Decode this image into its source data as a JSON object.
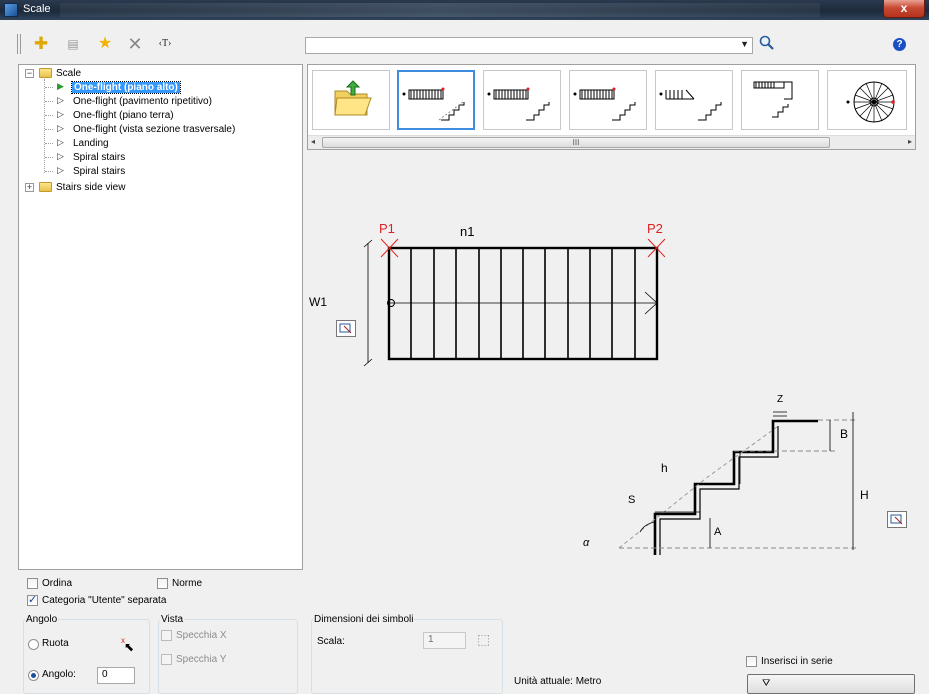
{
  "window": {
    "title": "Scale",
    "close_label": "x"
  },
  "toolbar": {
    "search_value": "",
    "help_label": "?",
    "text_tool_label": "‹T›"
  },
  "tree": {
    "root": "Scale",
    "items": [
      "One-flight (piano alto)",
      "One-flight (pavimento ripetitivo)",
      "One-flight (piano terra)",
      "One-flight (vista sezione trasversale)",
      "Landing",
      "Spiral stairs",
      "Spiral stairs"
    ],
    "second_root": "Stairs side view"
  },
  "thumbnails": {
    "scroll_mark": "III"
  },
  "preview": {
    "plan": {
      "p1": "P1",
      "p2": "P2",
      "n1": "n1",
      "w1": "W1"
    },
    "section": {
      "z": "Z",
      "b": "B",
      "h_small": "h",
      "h_big": "H",
      "s": "S",
      "a": "A",
      "alpha": "α"
    }
  },
  "options": {
    "ordina": "Ordina",
    "norme": "Norme",
    "categoria": "Categoria \"Utente\" separata",
    "angolo_group": "Angolo",
    "ruota": "Ruota",
    "angolo_label": "Angolo:",
    "angolo_value": "0",
    "vista_group": "Vista",
    "specchia_x": "Specchia X",
    "specchia_y": "Specchia Y",
    "dim_group": "Dimensioni dei simboli",
    "scala_label": "Scala:",
    "scala_value": "1",
    "unita": "Unità attuale: Metro",
    "inserisci": "Inserisci in serie"
  },
  "colors": {
    "selection": "#3399ff",
    "thumb_border": "#3d8ee0",
    "dim_red": "#e02020"
  }
}
